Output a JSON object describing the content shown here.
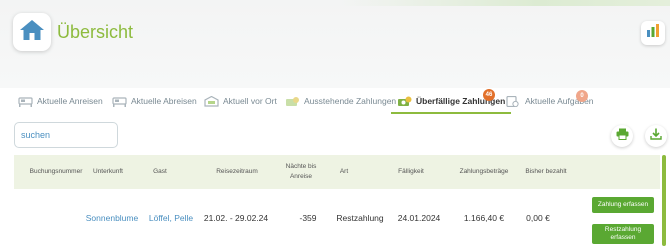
{
  "header": {
    "title": "Übersicht"
  },
  "tabs": [
    {
      "label": "Aktuelle Anreisen",
      "icon": "bed-icon"
    },
    {
      "label": "Aktuelle Abreisen",
      "icon": "bed-icon"
    },
    {
      "label": "Aktuell vor Ort",
      "icon": "house-icon"
    },
    {
      "label": "Ausstehende Zahlungen",
      "icon": "money-icon"
    },
    {
      "label": "Überfällige Zahlungen",
      "icon": "money-icon",
      "badge": "46",
      "active": true
    },
    {
      "label": "Aktuelle Aufgaben",
      "icon": "clipboard-icon",
      "badge": "0"
    }
  ],
  "search": {
    "placeholder": "suchen"
  },
  "table": {
    "headers": [
      "Buchungsnummer",
      "Unterkunft",
      "Gast",
      "Reisezeitraum",
      "Nächte bis Anreise",
      "Art",
      "Fälligkeit",
      "Zahlungsbeträge",
      "Bisher bezahlt"
    ],
    "rows": [
      {
        "booking_number": "",
        "accommodation": "Sonnenblume",
        "guest": "Löffel, Pelle",
        "period": "21.02. - 29.02.24",
        "nights": "-359",
        "type": "Restzahlung",
        "due": "24.01.2024",
        "amount": "1.166,40 €",
        "paid": "0,00 €",
        "actions": [
          "Zahlung erfassen",
          "Restzahlung erfassen"
        ]
      }
    ]
  },
  "colors": {
    "accent": "#8dbb3e",
    "button_green": "#5aa832",
    "link": "#4a8fc0",
    "badge_active": "#e2702a",
    "badge_inactive": "#f0a68a"
  }
}
